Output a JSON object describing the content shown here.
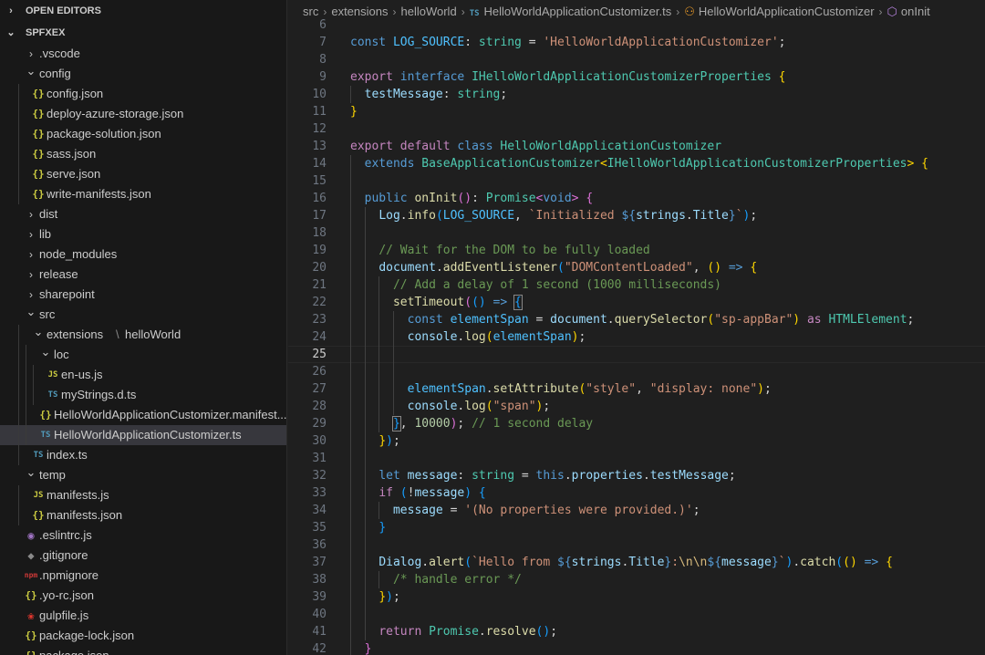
{
  "explorer": {
    "open_editors_label": "OPEN EDITORS",
    "project_label": "SPFXEX",
    "items": [
      {
        "label": ".vscode",
        "type": "folder",
        "open": false,
        "depth": 1
      },
      {
        "label": "config",
        "type": "folder",
        "open": true,
        "depth": 1
      },
      {
        "label": "config.json",
        "type": "json",
        "depth": 2
      },
      {
        "label": "deploy-azure-storage.json",
        "type": "json",
        "depth": 2
      },
      {
        "label": "package-solution.json",
        "type": "json",
        "depth": 2
      },
      {
        "label": "sass.json",
        "type": "json",
        "depth": 2
      },
      {
        "label": "serve.json",
        "type": "json",
        "depth": 2
      },
      {
        "label": "write-manifests.json",
        "type": "json",
        "depth": 2
      },
      {
        "label": "dist",
        "type": "folder",
        "open": false,
        "depth": 1
      },
      {
        "label": "lib",
        "type": "folder",
        "open": false,
        "depth": 1
      },
      {
        "label": "node_modules",
        "type": "folder",
        "open": false,
        "depth": 1
      },
      {
        "label": "release",
        "type": "folder",
        "open": false,
        "depth": 1
      },
      {
        "label": "sharepoint",
        "type": "folder",
        "open": false,
        "depth": 1
      },
      {
        "label": "src",
        "type": "folder",
        "open": true,
        "depth": 1
      },
      {
        "label": "extensions",
        "label2": "helloWorld",
        "type": "folder",
        "open": true,
        "depth": 2
      },
      {
        "label": "loc",
        "type": "folder",
        "open": true,
        "depth": 3
      },
      {
        "label": "en-us.js",
        "type": "js",
        "depth": 4
      },
      {
        "label": "myStrings.d.ts",
        "type": "ts",
        "depth": 4
      },
      {
        "label": "HelloWorldApplicationCustomizer.manifest...",
        "type": "json",
        "depth": 3
      },
      {
        "label": "HelloWorldApplicationCustomizer.ts",
        "type": "ts",
        "depth": 3,
        "selected": true
      },
      {
        "label": "index.ts",
        "type": "ts",
        "depth": 2
      },
      {
        "label": "temp",
        "type": "folder",
        "open": true,
        "depth": 1
      },
      {
        "label": "manifests.js",
        "type": "js",
        "depth": 2
      },
      {
        "label": "manifests.json",
        "type": "json",
        "depth": 2
      },
      {
        "label": ".eslintrc.js",
        "type": "eslint",
        "depth": 1
      },
      {
        "label": ".gitignore",
        "type": "git",
        "depth": 1
      },
      {
        "label": ".npmignore",
        "type": "npm",
        "depth": 1
      },
      {
        "label": ".yo-rc.json",
        "type": "json",
        "depth": 1
      },
      {
        "label": "gulpfile.js",
        "type": "gulp",
        "depth": 1
      },
      {
        "label": "package-lock.json",
        "type": "json",
        "depth": 1
      },
      {
        "label": "package.json",
        "type": "json",
        "depth": 1
      }
    ]
  },
  "icons": {
    "folder_closed": "chevron-right-icon",
    "folder_open": "chevron-down-icon",
    "json": "json-braces-icon",
    "js": "javascript-file-icon",
    "ts": "typescript-file-icon",
    "eslint": "eslint-icon",
    "git": "git-icon",
    "npm": "npm-icon",
    "gulp": "gulp-icon"
  },
  "colors": {
    "editor_bg": "#1f1f1f",
    "sidebar_bg": "#181818",
    "selection_bg": "#37373d",
    "keyword": "#569cd6",
    "control": "#c586c0",
    "type": "#4ec9b0",
    "function": "#dcdcaa",
    "variable": "#9cdcfe",
    "string": "#ce9178",
    "comment": "#6a9955",
    "number": "#b5cea8"
  },
  "breadcrumb": [
    "src",
    "extensions",
    "helloWorld",
    "HelloWorldApplicationCustomizer.ts",
    "HelloWorldApplicationCustomizer",
    "onInit"
  ],
  "editor": {
    "current_line": 25,
    "lines": [
      {
        "n": "6",
        "t": []
      },
      {
        "n": "7",
        "t": [
          [
            "const ",
            "kw"
          ],
          [
            "LOG_SOURCE",
            "cn"
          ],
          [
            ": ",
            "pn"
          ],
          [
            "string",
            "tp"
          ],
          [
            " = ",
            "pn"
          ],
          [
            "'HelloWorldApplicationCustomizer'",
            "st"
          ],
          [
            ";",
            "pn"
          ]
        ]
      },
      {
        "n": "8",
        "t": []
      },
      {
        "n": "9",
        "t": [
          [
            "export ",
            "ctl"
          ],
          [
            "interface ",
            "kw"
          ],
          [
            "IHelloWorldApplicationCustomizerProperties ",
            "tp"
          ],
          [
            "{",
            "b1"
          ]
        ]
      },
      {
        "n": "10",
        "t": [
          [
            "  ",
            "pn"
          ],
          [
            "testMessage",
            "vr"
          ],
          [
            ": ",
            "pn"
          ],
          [
            "string",
            "tp"
          ],
          [
            ";",
            "pn"
          ]
        ]
      },
      {
        "n": "11",
        "t": [
          [
            "}",
            "b1"
          ]
        ]
      },
      {
        "n": "12",
        "t": []
      },
      {
        "n": "13",
        "t": [
          [
            "export ",
            "ctl"
          ],
          [
            "default ",
            "ctl"
          ],
          [
            "class ",
            "kw"
          ],
          [
            "HelloWorldApplicationCustomizer",
            "tp"
          ]
        ]
      },
      {
        "n": "14",
        "t": [
          [
            "  ",
            "pn"
          ],
          [
            "extends ",
            "kw"
          ],
          [
            "BaseApplicationCustomizer",
            "tp"
          ],
          [
            "<",
            "b1"
          ],
          [
            "IHelloWorldApplicationCustomizerProperties",
            "tp"
          ],
          [
            ">",
            "b1"
          ],
          [
            " ",
            "pn"
          ],
          [
            "{",
            "b1"
          ]
        ]
      },
      {
        "n": "15",
        "t": []
      },
      {
        "n": "16",
        "t": [
          [
            "  ",
            "pn"
          ],
          [
            "public ",
            "kw"
          ],
          [
            "onInit",
            "fn"
          ],
          [
            "()",
            "b2"
          ],
          [
            ": ",
            "pn"
          ],
          [
            "Promise",
            "tp"
          ],
          [
            "<",
            "b2"
          ],
          [
            "void",
            "kw"
          ],
          [
            ">",
            "b2"
          ],
          [
            " ",
            "pn"
          ],
          [
            "{",
            "b2"
          ]
        ]
      },
      {
        "n": "17",
        "t": [
          [
            "    ",
            "pn"
          ],
          [
            "Log",
            "vr"
          ],
          [
            ".",
            "pn"
          ],
          [
            "info",
            "fn"
          ],
          [
            "(",
            "b3"
          ],
          [
            "LOG_SOURCE",
            "cn"
          ],
          [
            ", ",
            "pn"
          ],
          [
            "`Initialized ",
            "st"
          ],
          [
            "${",
            "kw"
          ],
          [
            "strings",
            "vr"
          ],
          [
            ".",
            "pn"
          ],
          [
            "Title",
            "vr"
          ],
          [
            "}",
            "kw"
          ],
          [
            "`",
            "st"
          ],
          [
            ")",
            "b3"
          ],
          [
            ";",
            "pn"
          ]
        ]
      },
      {
        "n": "18",
        "t": []
      },
      {
        "n": "19",
        "t": [
          [
            "    ",
            "pn"
          ],
          [
            "// Wait for the DOM to be fully loaded",
            "cm"
          ]
        ]
      },
      {
        "n": "20",
        "t": [
          [
            "    ",
            "pn"
          ],
          [
            "document",
            "vr"
          ],
          [
            ".",
            "pn"
          ],
          [
            "addEventListener",
            "fn"
          ],
          [
            "(",
            "b3"
          ],
          [
            "\"DOMContentLoaded\"",
            "st"
          ],
          [
            ", ",
            "pn"
          ],
          [
            "()",
            "b1"
          ],
          [
            " => ",
            "kw"
          ],
          [
            "{",
            "b1"
          ]
        ]
      },
      {
        "n": "21",
        "t": [
          [
            "      ",
            "pn"
          ],
          [
            "// Add a delay of 1 second (1000 milliseconds)",
            "cm"
          ]
        ]
      },
      {
        "n": "22",
        "t": [
          [
            "      ",
            "pn"
          ],
          [
            "setTimeout",
            "fn"
          ],
          [
            "(",
            "b2"
          ],
          [
            "()",
            "b3"
          ],
          [
            " => ",
            "kw"
          ],
          [
            "{",
            "b3bm"
          ]
        ]
      },
      {
        "n": "23",
        "t": [
          [
            "        ",
            "pn"
          ],
          [
            "const ",
            "kw"
          ],
          [
            "elementSpan",
            "cn"
          ],
          [
            " = ",
            "pn"
          ],
          [
            "document",
            "vr"
          ],
          [
            ".",
            "pn"
          ],
          [
            "querySelector",
            "fn"
          ],
          [
            "(",
            "b1"
          ],
          [
            "\"sp-appBar\"",
            "st"
          ],
          [
            ")",
            "b1"
          ],
          [
            " as ",
            "ctl"
          ],
          [
            "HTMLElement",
            "tp"
          ],
          [
            ";",
            "pn"
          ]
        ]
      },
      {
        "n": "24",
        "t": [
          [
            "        ",
            "pn"
          ],
          [
            "console",
            "vr"
          ],
          [
            ".",
            "pn"
          ],
          [
            "log",
            "fn"
          ],
          [
            "(",
            "b1"
          ],
          [
            "elementSpan",
            "cn"
          ],
          [
            ")",
            "b1"
          ],
          [
            ";",
            "pn"
          ]
        ]
      },
      {
        "n": "25",
        "t": []
      },
      {
        "n": "26",
        "t": []
      },
      {
        "n": "27",
        "t": [
          [
            "        ",
            "pn"
          ],
          [
            "elementSpan",
            "cn"
          ],
          [
            ".",
            "pn"
          ],
          [
            "setAttribute",
            "fn"
          ],
          [
            "(",
            "b1"
          ],
          [
            "\"style\"",
            "st"
          ],
          [
            ", ",
            "pn"
          ],
          [
            "\"display: none\"",
            "st"
          ],
          [
            ")",
            "b1"
          ],
          [
            ";",
            "pn"
          ]
        ]
      },
      {
        "n": "28",
        "t": [
          [
            "        ",
            "pn"
          ],
          [
            "console",
            "vr"
          ],
          [
            ".",
            "pn"
          ],
          [
            "log",
            "fn"
          ],
          [
            "(",
            "b1"
          ],
          [
            "\"span\"",
            "st"
          ],
          [
            ")",
            "b1"
          ],
          [
            ";",
            "pn"
          ]
        ]
      },
      {
        "n": "29",
        "t": [
          [
            "      ",
            "pn"
          ],
          [
            "}",
            "b3bm"
          ],
          [
            ", ",
            "pn"
          ],
          [
            "10000",
            "nm"
          ],
          [
            ")",
            "b2"
          ],
          [
            "; ",
            "pn"
          ],
          [
            "// 1 second delay",
            "cm"
          ]
        ]
      },
      {
        "n": "30",
        "t": [
          [
            "    ",
            "pn"
          ],
          [
            "}",
            "b1"
          ],
          [
            ")",
            "b3"
          ],
          [
            ";",
            "pn"
          ]
        ]
      },
      {
        "n": "31",
        "t": []
      },
      {
        "n": "32",
        "t": [
          [
            "    ",
            "pn"
          ],
          [
            "let ",
            "kw"
          ],
          [
            "message",
            "vr"
          ],
          [
            ": ",
            "pn"
          ],
          [
            "string",
            "tp"
          ],
          [
            " = ",
            "pn"
          ],
          [
            "this",
            "kw"
          ],
          [
            ".",
            "pn"
          ],
          [
            "properties",
            "vr"
          ],
          [
            ".",
            "pn"
          ],
          [
            "testMessage",
            "vr"
          ],
          [
            ";",
            "pn"
          ]
        ]
      },
      {
        "n": "33",
        "t": [
          [
            "    ",
            "pn"
          ],
          [
            "if ",
            "ctl"
          ],
          [
            "(",
            "b3"
          ],
          [
            "!",
            "pn"
          ],
          [
            "message",
            "vr"
          ],
          [
            ")",
            "b3"
          ],
          [
            " ",
            "pn"
          ],
          [
            "{",
            "b3"
          ]
        ]
      },
      {
        "n": "34",
        "t": [
          [
            "      ",
            "pn"
          ],
          [
            "message",
            "vr"
          ],
          [
            " = ",
            "pn"
          ],
          [
            "'(No properties were provided.)'",
            "st"
          ],
          [
            ";",
            "pn"
          ]
        ]
      },
      {
        "n": "35",
        "t": [
          [
            "    ",
            "pn"
          ],
          [
            "}",
            "b3"
          ]
        ]
      },
      {
        "n": "36",
        "t": []
      },
      {
        "n": "37",
        "t": [
          [
            "    ",
            "pn"
          ],
          [
            "Dialog",
            "vr"
          ],
          [
            ".",
            "pn"
          ],
          [
            "alert",
            "fn"
          ],
          [
            "(",
            "b3"
          ],
          [
            "`Hello from ",
            "st"
          ],
          [
            "${",
            "kw"
          ],
          [
            "strings",
            "vr"
          ],
          [
            ".",
            "pn"
          ],
          [
            "Title",
            "vr"
          ],
          [
            "}",
            "kw"
          ],
          [
            ":",
            "st"
          ],
          [
            "\\n\\n",
            "es"
          ],
          [
            "${",
            "kw"
          ],
          [
            "message",
            "vr"
          ],
          [
            "}",
            "kw"
          ],
          [
            "`",
            "st"
          ],
          [
            ")",
            "b3"
          ],
          [
            ".",
            "pn"
          ],
          [
            "catch",
            "fn"
          ],
          [
            "(",
            "b3"
          ],
          [
            "()",
            "b1"
          ],
          [
            " => ",
            "kw"
          ],
          [
            "{",
            "b1"
          ]
        ]
      },
      {
        "n": "38",
        "t": [
          [
            "      ",
            "pn"
          ],
          [
            "/* handle error */",
            "cm"
          ]
        ]
      },
      {
        "n": "39",
        "t": [
          [
            "    ",
            "pn"
          ],
          [
            "}",
            "b1"
          ],
          [
            ")",
            "b3"
          ],
          [
            ";",
            "pn"
          ]
        ]
      },
      {
        "n": "40",
        "t": []
      },
      {
        "n": "41",
        "t": [
          [
            "    ",
            "pn"
          ],
          [
            "return ",
            "ctl"
          ],
          [
            "Promise",
            "tp"
          ],
          [
            ".",
            "pn"
          ],
          [
            "resolve",
            "fn"
          ],
          [
            "()",
            "b3"
          ],
          [
            ";",
            "pn"
          ]
        ]
      },
      {
        "n": "42",
        "t": [
          [
            "  ",
            "pn"
          ],
          [
            "}",
            "b2"
          ]
        ]
      }
    ]
  }
}
